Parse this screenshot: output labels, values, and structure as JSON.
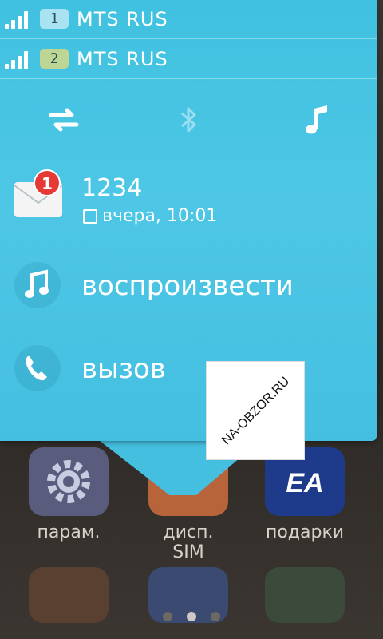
{
  "status": {
    "sims": [
      {
        "slot": "1",
        "operator": "MTS RUS"
      },
      {
        "slot": "2",
        "operator": "MTS RUS"
      }
    ]
  },
  "quick_toggles": [
    {
      "icon": "data-transfer-icon"
    },
    {
      "icon": "bluetooth-icon"
    },
    {
      "icon": "music-note-icon"
    }
  ],
  "notification": {
    "icon": "envelope-icon",
    "count": "1",
    "sender": "1234",
    "time": "вчера, 10:01"
  },
  "actions": [
    {
      "icon": "music-note-icon",
      "label": "воспроизвести"
    },
    {
      "icon": "phone-icon",
      "label": "вызов"
    }
  ],
  "watermark": "NA-OBZOR.RU",
  "home_apps": [
    {
      "icon": "gear-icon",
      "label": "парам.",
      "color": "#5a5c7e"
    },
    {
      "icon": "sim-manager-icon",
      "label": "дисп. SIM",
      "color": "#b8643a"
    },
    {
      "icon": "ea-logo-icon",
      "label": "подарки",
      "color": "#1e3a8a"
    }
  ],
  "colors": {
    "panel": "#45bfe0",
    "badge": "#e53935"
  }
}
